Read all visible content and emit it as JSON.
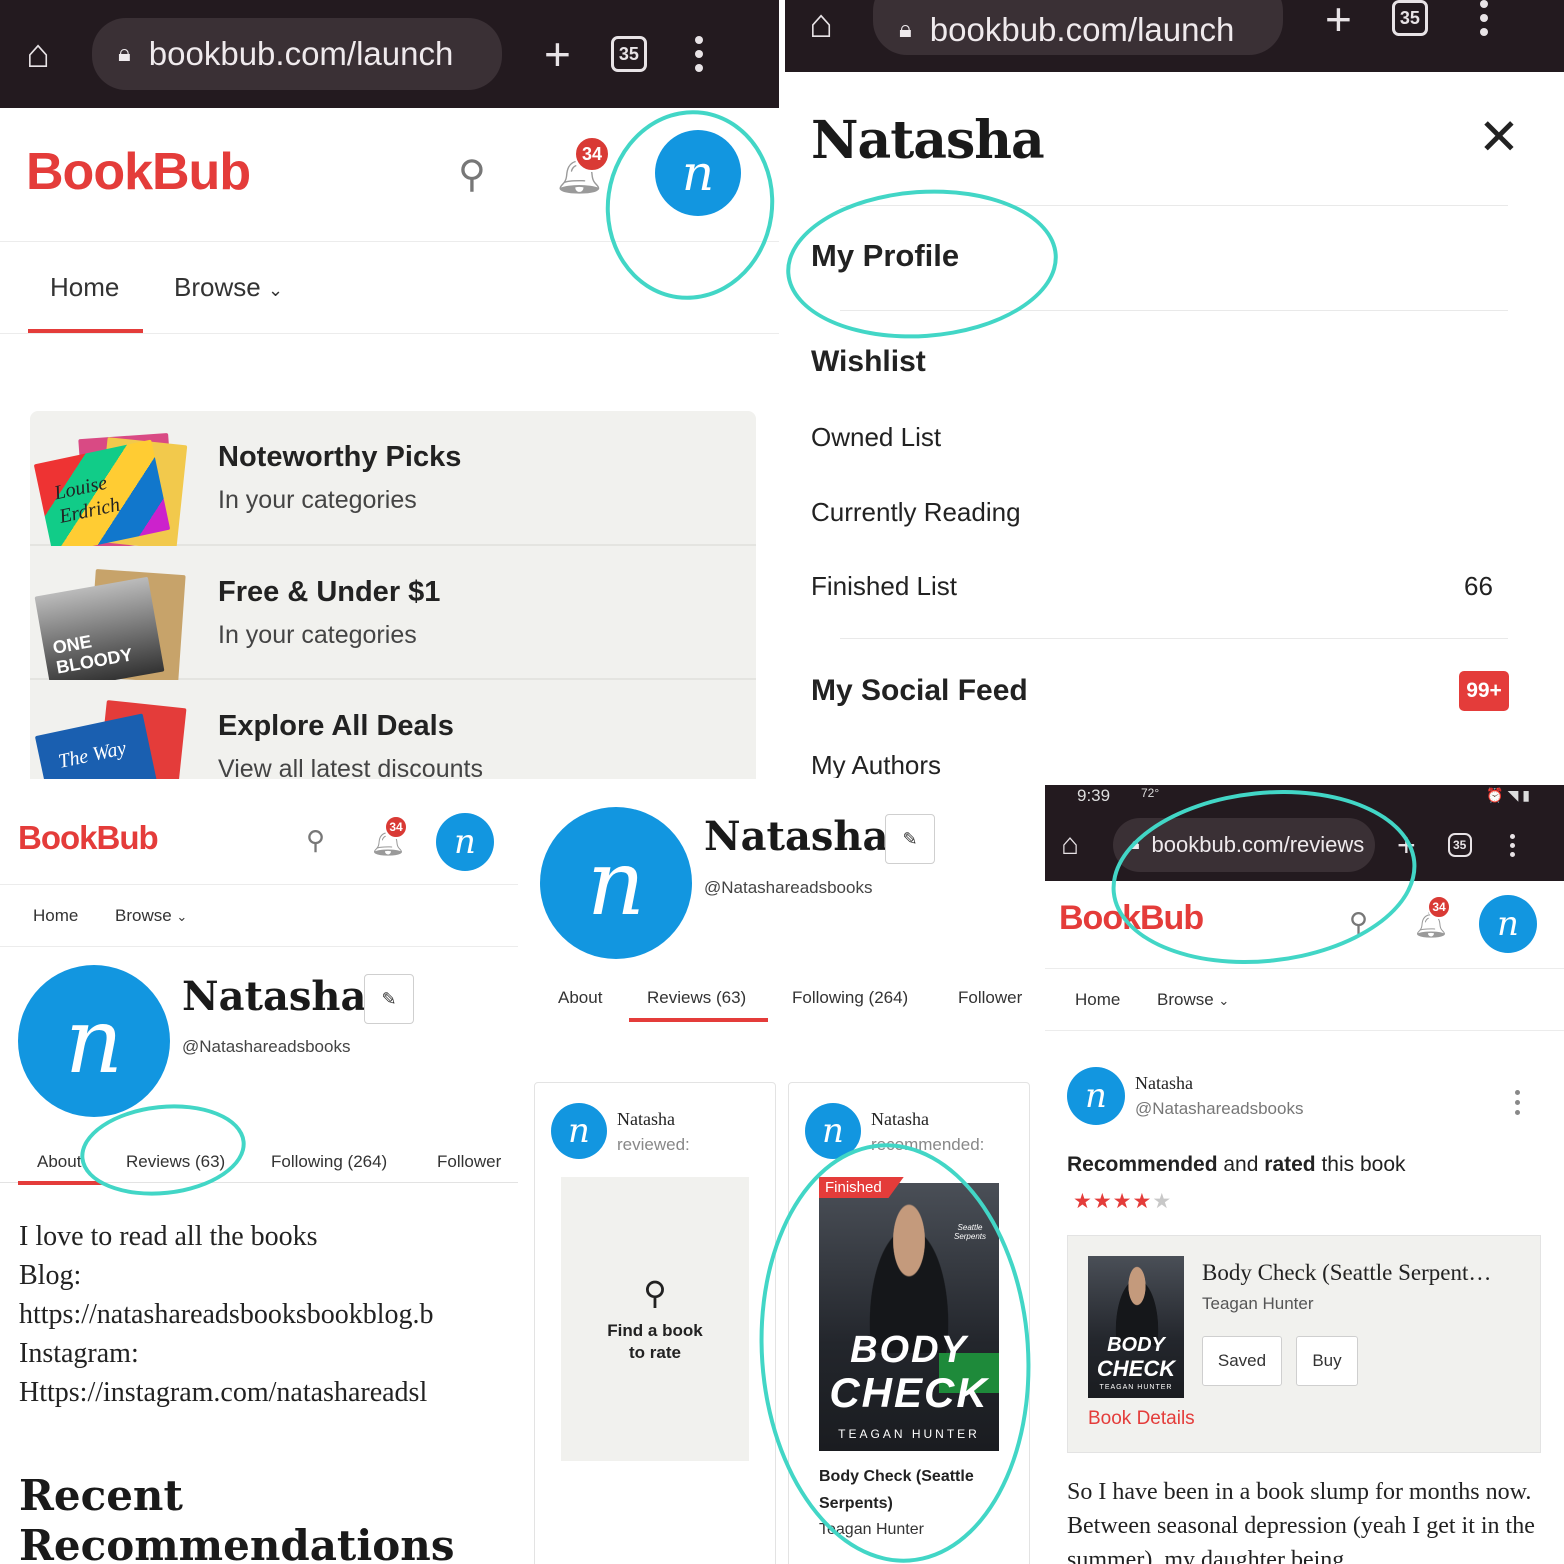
{
  "browser": {
    "url_launch": "bookbub.com/launch",
    "url_reviews": "bookbub.com/reviews",
    "tab_count": "35",
    "status_time": "9:39",
    "status_temp": "72°"
  },
  "header": {
    "logo": "BookBub",
    "notification_count": "34",
    "avatar_letter": "n"
  },
  "nav": {
    "home": "Home",
    "browse": "Browse"
  },
  "deals": [
    {
      "title": "Noteworthy Picks",
      "subtitle": "In your categories"
    },
    {
      "title": "Free & Under $1",
      "subtitle": "In your categories"
    },
    {
      "title": "Explore All Deals",
      "subtitle": "View all latest discounts"
    }
  ],
  "deal_cover_text": {
    "author": "Louise Erdrich",
    "one_bloody": "ONE BLOODY",
    "the_way": "The Way"
  },
  "menu": {
    "name": "Natasha",
    "my_profile": "My Profile",
    "wishlist": "Wishlist",
    "owned": "Owned List",
    "reading": "Currently Reading",
    "finished": "Finished List",
    "finished_count": "66",
    "social": "My Social Feed",
    "social_count": "99+",
    "authors": "My Authors"
  },
  "profile": {
    "name": "Natasha",
    "handle": "@Natashareadsbooks",
    "tabs": [
      "About",
      "Reviews (63)",
      "Following (264)",
      "Follower"
    ],
    "bio": [
      "I love to read all the books",
      "Blog:",
      "https://natashareadsbooksbookblog.b",
      "Instagram:",
      "Https://instagram.com/natashareadsl"
    ],
    "recent_heading": "Recent Recommendations"
  },
  "reviews": {
    "card1_name": "Natasha",
    "card1_action": "reviewed:",
    "find_book": "Find a book to rate",
    "card2_name": "Natasha",
    "card2_action": "recommended:",
    "finished_tag": "Finished",
    "book_title": "Body Check (Seattle Serpents)",
    "book_author": "Teagan Hunter"
  },
  "review_detail": {
    "name": "Natasha",
    "handle": "@Natashareadsbooks",
    "recommended_word": "Recommended",
    "and_word": " and ",
    "rated_word": "rated",
    "rest": " this book",
    "stars_filled": 4,
    "stars_total": 5,
    "book_title": "Body Check (Seattle Serpent…",
    "book_author": "Teagan Hunter",
    "saved": "Saved",
    "buy": "Buy",
    "details": "Book Details",
    "body": "So I have been in a book slump for months now. Between seasonal depression (yeah I get it in the summer), my daughter being"
  },
  "cover_text": {
    "line1": "BODY",
    "line2": "CHECK",
    "author": "TEAGAN HUNTER",
    "series": "Seattle Serpents"
  },
  "colors": {
    "accent": "#e43c3a",
    "avatar": "#1296e0",
    "annotation": "#42d6c6",
    "chrome": "#231a1f"
  }
}
